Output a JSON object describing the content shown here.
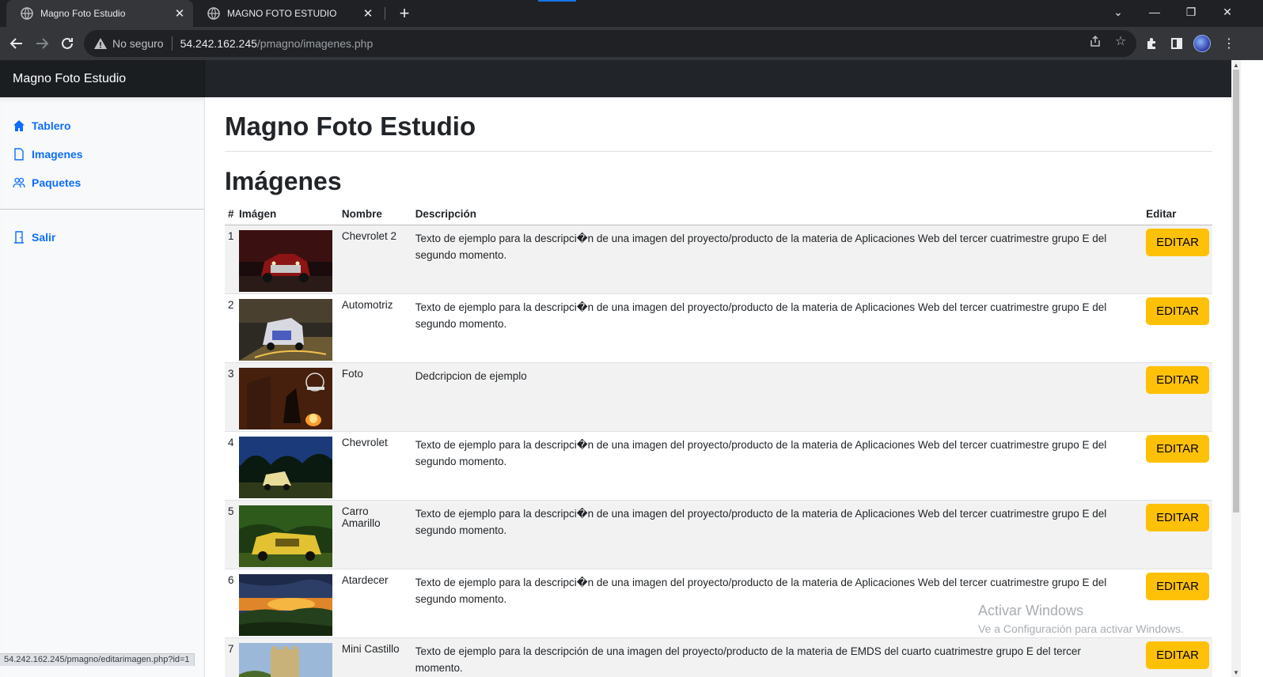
{
  "browser": {
    "tabs": [
      {
        "title": "Magno Foto Estudio",
        "active": true
      },
      {
        "title": "MAGNO FOTO ESTUDIO",
        "active": false
      }
    ],
    "close_symbol": "✕",
    "new_tab_symbol": "+",
    "security_label": "No seguro",
    "url_host": "54.242.162.245",
    "url_path": "/pmagno/imagenes.php",
    "status_url": "54.242.162.245/pmagno/editarimagen.php?id=1"
  },
  "navbar": {
    "brand": "Magno Foto Estudio"
  },
  "sidebar": {
    "items": [
      {
        "label": "Tablero",
        "icon": "house-icon"
      },
      {
        "label": "Imagenes",
        "icon": "file-icon"
      },
      {
        "label": "Paquetes",
        "icon": "people-icon"
      }
    ],
    "logout": {
      "label": "Salir",
      "icon": "door-icon"
    }
  },
  "main": {
    "title": "Magno Foto Estudio",
    "section_title": "Imágenes"
  },
  "table": {
    "headers": {
      "num": "#",
      "image": "Imágen",
      "name": "Nombre",
      "description": "Descripción",
      "edit": "Editar"
    },
    "edit_label": "EDITAR",
    "rows": [
      {
        "num": "1",
        "name": "Chevrolet 2",
        "description": "Texto de ejemplo para la descripci�n de una imagen del proyecto/producto de la materia de Aplicaciones Web del tercer cuatrimestre grupo E del segundo momento."
      },
      {
        "num": "2",
        "name": "Automotriz",
        "description": "Texto de ejemplo para la descripci�n de una imagen del proyecto/producto de la materia de Aplicaciones Web del tercer cuatrimestre grupo E del segundo momento."
      },
      {
        "num": "3",
        "name": "Foto",
        "description": "Dedcripcion de ejemplo"
      },
      {
        "num": "4",
        "name": "Chevrolet",
        "description": "Texto de ejemplo para la descripci�n de una imagen del proyecto/producto de la materia de Aplicaciones Web del tercer cuatrimestre grupo E del segundo momento."
      },
      {
        "num": "5",
        "name": "Carro Amarillo",
        "description": "Texto de ejemplo para la descripci�n de una imagen del proyecto/producto de la materia de Aplicaciones Web del tercer cuatrimestre grupo E del segundo momento."
      },
      {
        "num": "6",
        "name": "Atardecer",
        "description": "Texto de ejemplo para la descripci�n de una imagen del proyecto/producto de la materia de Aplicaciones Web del tercer cuatrimestre grupo E del segundo momento."
      },
      {
        "num": "7",
        "name": "Mini Castillo",
        "description": "Texto de ejemplo para la descripción de una imagen del proyecto/producto de la materia de EMDS del cuarto cuatrimestre grupo E del tercer momento."
      }
    ]
  },
  "watermark": {
    "line1": "Activar Windows",
    "line2": "Ve a Configuración para activar Windows."
  },
  "colors": {
    "edit_button": "#ffc107",
    "sidebar_link": "#0d6efd",
    "navbar": "#212529"
  }
}
